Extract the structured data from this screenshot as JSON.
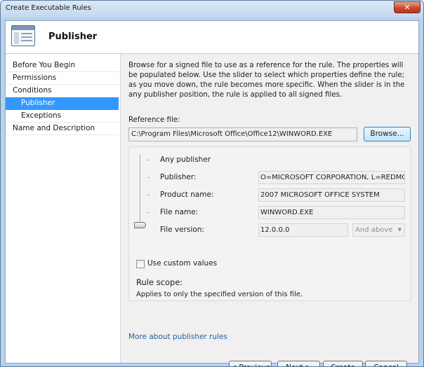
{
  "window": {
    "title": "Create Executable Rules",
    "close_glyph": "✕"
  },
  "header": {
    "title": "Publisher",
    "icon": "wizard-page-icon"
  },
  "nav": {
    "items": [
      {
        "label": "Before You Begin"
      },
      {
        "label": "Permissions"
      },
      {
        "label": "Conditions"
      },
      {
        "label": "Publisher",
        "selected": true
      },
      {
        "label": "Exceptions"
      },
      {
        "label": "Name and Description"
      }
    ]
  },
  "main": {
    "description": "Browse for a signed file to use as a reference for the rule. The properties will be populated below. Use the slider to select which properties define the rule; as you move down, the rule becomes more specific. When the slider is in the any publisher position, the rule is applied to all signed files.",
    "reference_file_label": "Reference file:",
    "reference_file_value": "C:\\Program Files\\Microsoft Office\\Office12\\WINWORD.EXE",
    "browse_label": "Browse...",
    "levels": {
      "any_publisher": "Any publisher",
      "publisher_label": "Publisher:",
      "publisher_value": "O=MICROSOFT CORPORATION, L=REDMOND,",
      "product_label": "Product name:",
      "product_value": "2007 MICROSOFT OFFICE SYSTEM",
      "file_name_label": "File name:",
      "file_name_value": "WINWORD.EXE",
      "file_version_label": "File version:",
      "file_version_value": "12.0.0.0",
      "version_operator": "And above",
      "slider_level": "File version"
    },
    "use_custom_values_label": "Use custom values",
    "use_custom_values_checked": false,
    "rule_scope_title": "Rule scope:",
    "rule_scope_text": "Applies to only the specified version of this file.",
    "more_link": "More about publisher rules"
  },
  "footer": {
    "previous_label": "< Previous",
    "next_label": "Next >",
    "create_label": "Create",
    "cancel_label": "Cancel"
  },
  "colors": {
    "selection": "#3399ff",
    "link": "#1f5f9f",
    "close_button": "#c8492c"
  }
}
